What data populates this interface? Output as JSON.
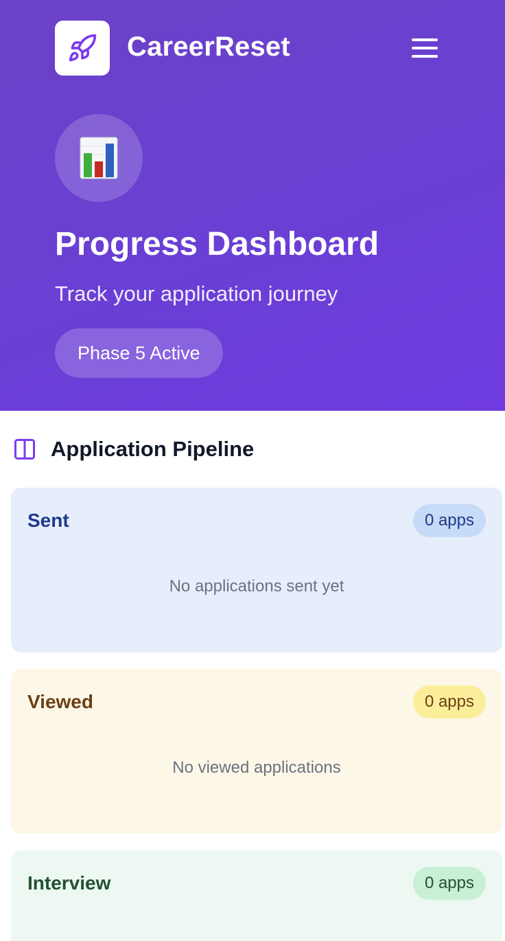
{
  "header": {
    "brand": "CareerReset",
    "logo_icon": "rocket-icon",
    "menu_icon": "hamburger-menu-icon"
  },
  "hero": {
    "icon": "bar-chart-icon",
    "title": "Progress Dashboard",
    "subtitle": "Track your application journey",
    "phase_badge": "Phase 5 Active"
  },
  "pipeline": {
    "icon": "columns-icon",
    "title": "Application Pipeline",
    "stages": [
      {
        "name": "Sent",
        "count": "0 apps",
        "empty_text": "No applications sent yet",
        "bg": "#e7eefb",
        "name_color": "#1e3a8a",
        "badge_bg": "#c6dbf7",
        "badge_color": "#1e3a8a"
      },
      {
        "name": "Viewed",
        "count": "0 apps",
        "empty_text": "No viewed applications",
        "bg": "#fdf7e8",
        "name_color": "#6b3f14",
        "badge_bg": "#fbee9a",
        "badge_color": "#6b3f14"
      },
      {
        "name": "Interview",
        "count": "0 apps",
        "empty_text": "",
        "bg": "#ecf8f1",
        "name_color": "#24512f",
        "badge_bg": "#c9efd6",
        "badge_color": "#24512f"
      }
    ]
  },
  "colors": {
    "accent": "#7c3aed",
    "hero_gradient_start": "#6b42c7",
    "hero_gradient_end": "#6f3be0"
  }
}
